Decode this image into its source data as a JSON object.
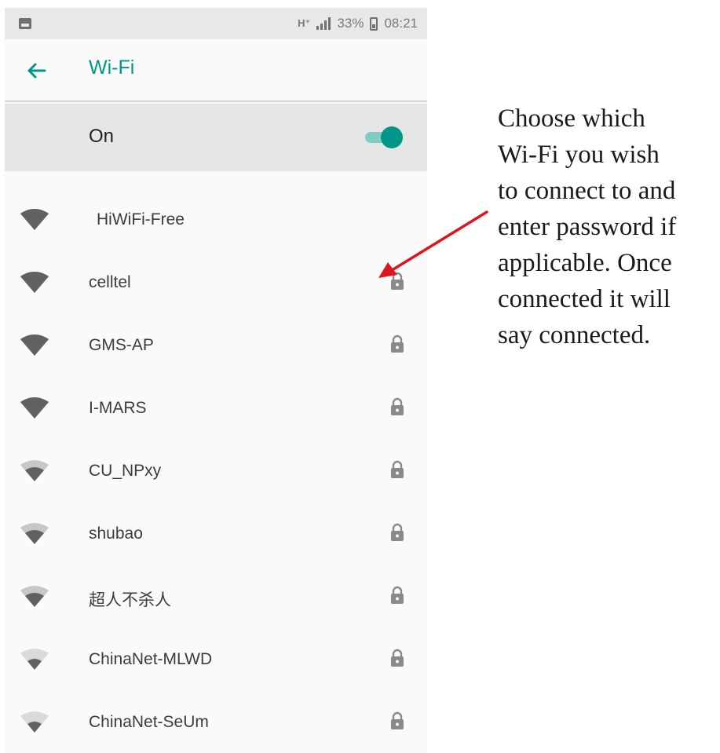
{
  "status_bar": {
    "network_type": "H⁺",
    "battery": "33%",
    "time": "08:21"
  },
  "app_bar": {
    "back_icon": "arrow-back-icon",
    "title": "Wi-Fi"
  },
  "wifi_switch": {
    "label": "On",
    "state": "on"
  },
  "networks": [
    {
      "name": "HiWiFi-Free",
      "signal": "strong",
      "secured": false
    },
    {
      "name": "celltel",
      "signal": "strong",
      "secured": true
    },
    {
      "name": "GMS-AP",
      "signal": "strong",
      "secured": true
    },
    {
      "name": "I-MARS",
      "signal": "strong",
      "secured": true
    },
    {
      "name": "CU_NPxy",
      "signal": "medium",
      "secured": true
    },
    {
      "name": "shubao",
      "signal": "medium",
      "secured": true
    },
    {
      "name": "超人不杀人",
      "signal": "medium",
      "secured": true
    },
    {
      "name": "ChinaNet-MLWD",
      "signal": "weak",
      "secured": true
    },
    {
      "name": "ChinaNet-SeUm",
      "signal": "weak",
      "secured": true
    }
  ],
  "annotation": {
    "lines": [
      "Choose which",
      "Wi-Fi you wish",
      "to connect to and",
      "enter password if",
      "applicable. Once",
      "connected it will",
      "say connected."
    ],
    "arrow_color": "#e0141c"
  },
  "colors": {
    "accent": "#009688",
    "accent_light": "#80cbc4"
  }
}
